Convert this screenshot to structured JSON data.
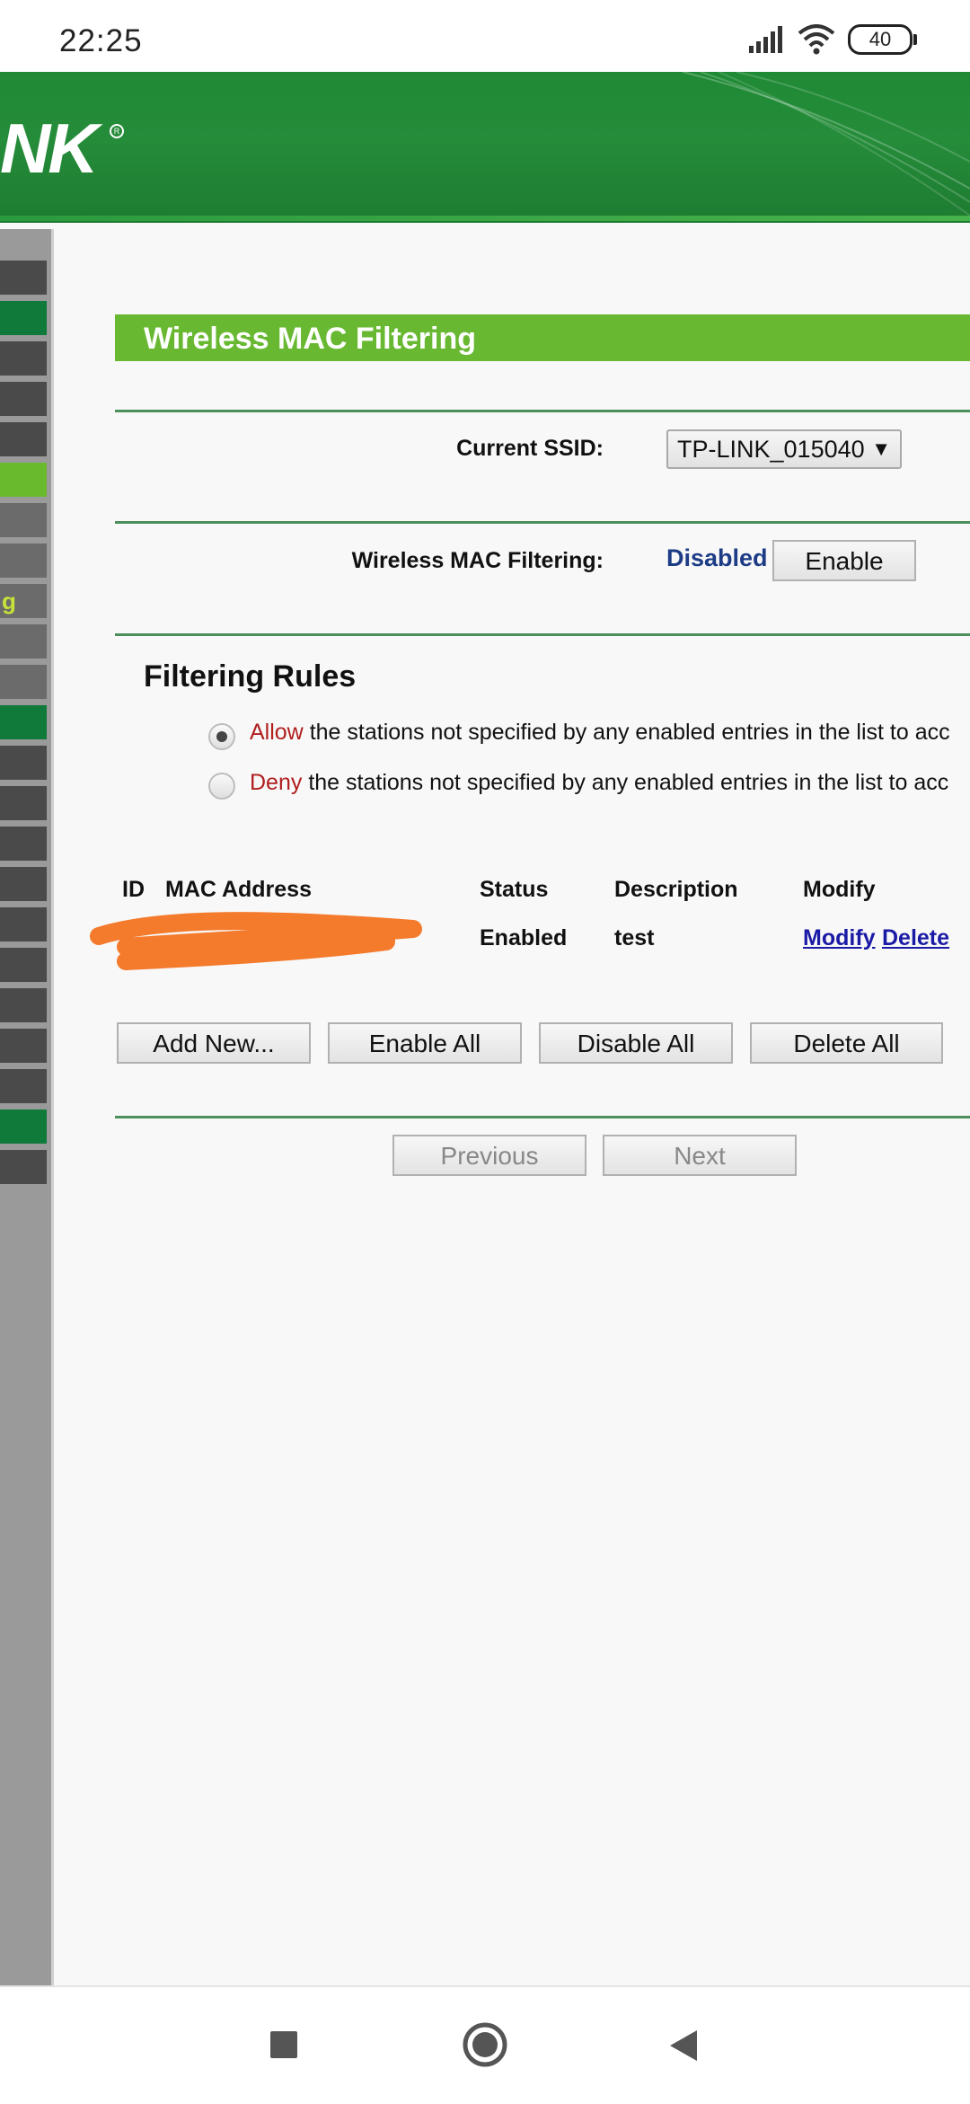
{
  "status_bar": {
    "time": "22:25",
    "battery": "40"
  },
  "header": {
    "logo_text": "NK",
    "logo_reg": "R"
  },
  "sidebar": {
    "partial_label": "g"
  },
  "page": {
    "title": "Wireless MAC Filtering",
    "current_ssid_label": "Current SSID:",
    "current_ssid_value": "TP-LINK_015040",
    "mac_filtering_label": "Wireless MAC Filtering:",
    "mac_filtering_state": "Disabled",
    "enable_button": "Enable",
    "filtering_rules_title": "Filtering Rules",
    "rules": [
      {
        "keyword": "Allow",
        "text": " the stations not specified by any enabled entries in the list to acc",
        "selected": true
      },
      {
        "keyword": "Deny",
        "text": " the stations not specified by any enabled entries in the list to acc",
        "selected": false
      }
    ],
    "table": {
      "headers": [
        "ID",
        "MAC Address",
        "Status",
        "Description",
        "Modify"
      ],
      "rows": [
        {
          "status": "Enabled",
          "description": "test",
          "modify": "Modify",
          "delete": "Delete"
        }
      ]
    },
    "buttons": {
      "add_new": "Add New...",
      "enable_all": "Enable All",
      "disable_all": "Disable All",
      "delete_all": "Delete All"
    },
    "pagination": {
      "previous": "Previous",
      "next": "Next"
    }
  },
  "colors": {
    "header_green": "#1f8a35",
    "title_bar": "#68b832",
    "link": "#1a1aa6",
    "keyword_red": "#b01e1e",
    "disabled_blue": "#1d3c86",
    "redaction_orange": "#f47a2c"
  },
  "icons": {
    "signal": "signal-icon",
    "wifi": "wifi-icon",
    "recent_apps": "square-icon",
    "home": "circle-icon",
    "back": "triangle-back-icon"
  }
}
